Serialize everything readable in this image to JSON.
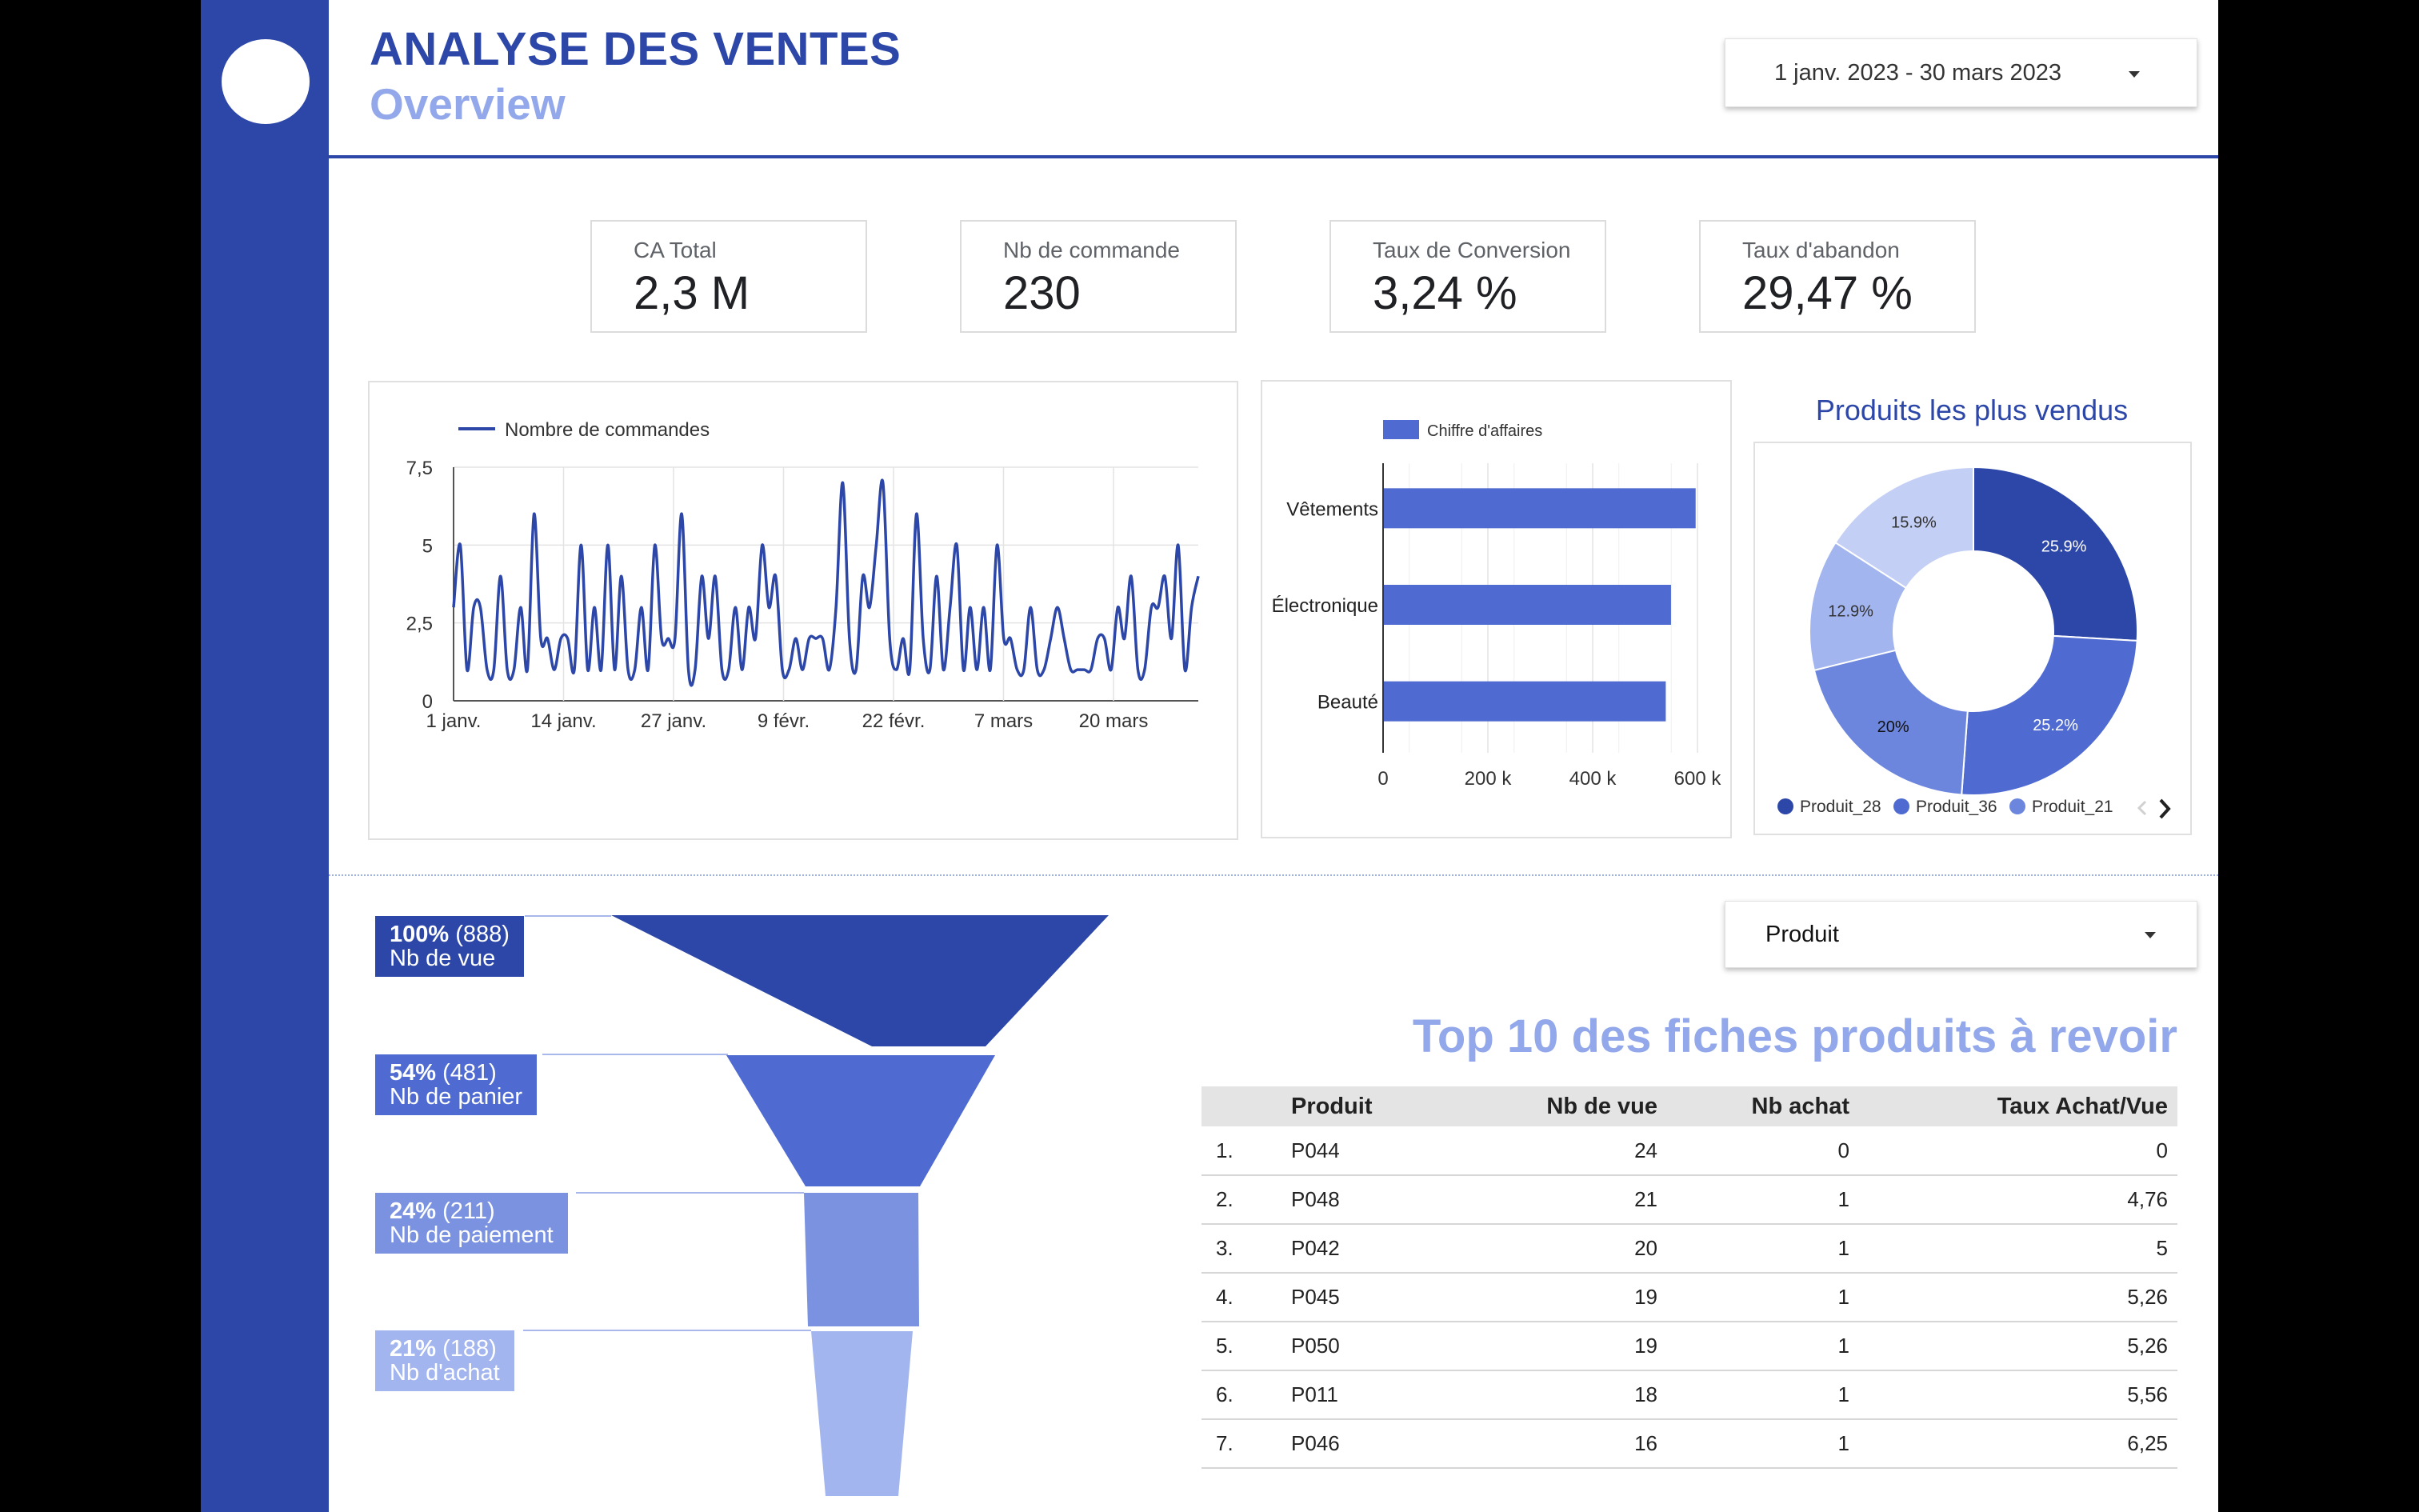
{
  "header": {
    "title": "ANALYSE DES VENTES",
    "subtitle": "Overview",
    "date_range": "1 janv. 2023 - 30 mars 2023"
  },
  "kpis": [
    {
      "label": "CA Total",
      "value": "2,3 M"
    },
    {
      "label": "Nb de commande",
      "value": "230"
    },
    {
      "label": "Taux de Conversion",
      "value": "3,24 %"
    },
    {
      "label": "Taux d'abandon",
      "value": "29,47 %"
    }
  ],
  "colors": {
    "primary": "#2c47a8",
    "secondary": "#4f6bd1",
    "tertiary": "#7a92e0",
    "light": "#a3b5ee",
    "lightest": "#c3cff5",
    "accent_text": "#93a8ea"
  },
  "chart_data": [
    {
      "type": "line",
      "legend": "Nombre de commandes",
      "x_tick_labels": [
        "1 janv.",
        "14 janv.",
        "27 janv.",
        "9 févr.",
        "22 févr.",
        "7 mars",
        "20 mars"
      ],
      "y_tick_labels": [
        "0",
        "2,5",
        "5",
        "7,5"
      ],
      "ylim": [
        0,
        7.5
      ],
      "x_start": "2023-01-01",
      "values": [
        3,
        5,
        1,
        3,
        3,
        1,
        1,
        4,
        1,
        1,
        3,
        1,
        6,
        2,
        2,
        1,
        2,
        2,
        1,
        5,
        1,
        3,
        1,
        5,
        1,
        4,
        1,
        1,
        3,
        1,
        5,
        2,
        2,
        2,
        6,
        1,
        1,
        4,
        2,
        4,
        1,
        1,
        3,
        1,
        3,
        2,
        5,
        3,
        4,
        1,
        1,
        2,
        1,
        2,
        2,
        2,
        1,
        3,
        7,
        2,
        1,
        4,
        3,
        5,
        7,
        2,
        1,
        2,
        1,
        6,
        2,
        1,
        4,
        1,
        3,
        5,
        1,
        3,
        1,
        3,
        1,
        5,
        2,
        2,
        1,
        1,
        3,
        1,
        1,
        2,
        3,
        2,
        1,
        1,
        1,
        1,
        2,
        2,
        1,
        3,
        2,
        4,
        1,
        1,
        3,
        3,
        4,
        2,
        5,
        1,
        3,
        4
      ],
      "grid": true,
      "legend_position": "top-left"
    },
    {
      "type": "bar",
      "orientation": "horizontal",
      "legend": "Chiffre d'affaires",
      "categories": [
        "Vêtements",
        "Électronique",
        "Beauté"
      ],
      "values": [
        595000,
        548000,
        538000
      ],
      "x_tick_labels": [
        "0",
        "200 k",
        "400 k",
        "600 k"
      ],
      "xlim": [
        0,
        600000
      ],
      "grid": true,
      "legend_position": "top"
    },
    {
      "type": "pie",
      "style": "donut",
      "title": "Produits les plus vendus",
      "slices": [
        {
          "label": "Produit_28",
          "value": 25.9,
          "text": "25.9%",
          "color": "#2c47a8"
        },
        {
          "label": "Produit_36",
          "value": 25.2,
          "text": "25.2%",
          "color": "#4f6bd1"
        },
        {
          "label": "Produit_21",
          "value": 20.0,
          "text": "20%",
          "color": "#6c86de"
        },
        {
          "label": "",
          "value": 12.9,
          "text": "12.9%",
          "color": "#a3b5ee"
        },
        {
          "label": "",
          "value": 15.9,
          "text": "15.9%",
          "color": "#c3cff5"
        }
      ],
      "legend_items": [
        "Produit_28",
        "Produit_36",
        "Produit_21"
      ],
      "legend_position": "bottom"
    }
  ],
  "funnel": [
    {
      "pct": "100%",
      "count": "(888)",
      "label": "Nb de vue",
      "color": "#2c47a8"
    },
    {
      "pct": "54%",
      "count": "(481)",
      "label": "Nb de panier",
      "color": "#4f6bd1"
    },
    {
      "pct": "24%",
      "count": "(211)",
      "label": "Nb de paiement",
      "color": "#7a92e0"
    },
    {
      "pct": "21%",
      "count": "(188)",
      "label": "Nb d'achat",
      "color": "#a3b5ee"
    }
  ],
  "product_filter": {
    "value": "Produit"
  },
  "table": {
    "title": "Top 10 des fiches produits à revoir",
    "headers": {
      "product": "Produit",
      "views": "Nb de vue",
      "purchases": "Nb achat",
      "ratio": "Taux Achat/Vue"
    },
    "rows": [
      {
        "idx": "1.",
        "product": "P044",
        "views": "24",
        "purchases": "0",
        "ratio": "0"
      },
      {
        "idx": "2.",
        "product": "P048",
        "views": "21",
        "purchases": "1",
        "ratio": "4,76"
      },
      {
        "idx": "3.",
        "product": "P042",
        "views": "20",
        "purchases": "1",
        "ratio": "5"
      },
      {
        "idx": "4.",
        "product": "P045",
        "views": "19",
        "purchases": "1",
        "ratio": "5,26"
      },
      {
        "idx": "5.",
        "product": "P050",
        "views": "19",
        "purchases": "1",
        "ratio": "5,26"
      },
      {
        "idx": "6.",
        "product": "P011",
        "views": "18",
        "purchases": "1",
        "ratio": "5,56"
      },
      {
        "idx": "7.",
        "product": "P046",
        "views": "16",
        "purchases": "1",
        "ratio": "6,25"
      }
    ]
  }
}
